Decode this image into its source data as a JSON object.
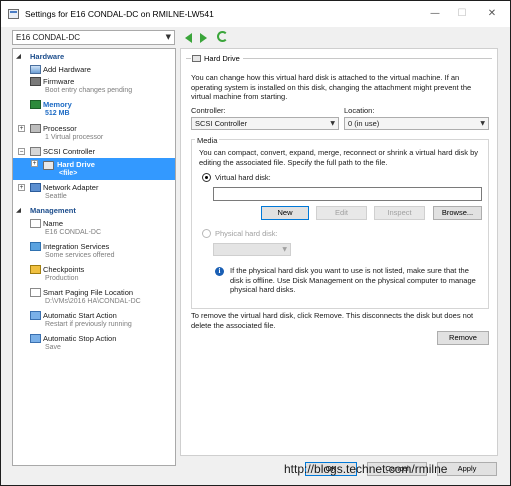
{
  "window": {
    "title": "Settings for E16 CONDAL-DC on RMILNE-LW541",
    "minimize_glyph": "—",
    "maximize_glyph": "☐",
    "close_glyph": "✕"
  },
  "toolbar": {
    "vm_name": "E16 CONDAL-DC",
    "back_icon": "back-arrow-icon",
    "forward_icon": "forward-arrow-icon",
    "refresh_icon": "refresh-icon"
  },
  "sidebar": {
    "hardware_heading": "Hardware",
    "management_heading": "Management",
    "hardware": [
      {
        "label": "Add Hardware",
        "sub": ""
      },
      {
        "label": "Firmware",
        "sub": "Boot entry changes pending"
      },
      {
        "label": "Memory",
        "sub": "512 MB"
      },
      {
        "label": "Processor",
        "sub": "1 Virtual processor"
      },
      {
        "label": "SCSI Controller",
        "sub": ""
      },
      {
        "label": "Hard Drive",
        "sub": "<file>"
      },
      {
        "label": "Network Adapter",
        "sub": "Seattle"
      }
    ],
    "management": [
      {
        "label": "Name",
        "sub": "E16 CONDAL-DC"
      },
      {
        "label": "Integration Services",
        "sub": "Some services offered"
      },
      {
        "label": "Checkpoints",
        "sub": "Production"
      },
      {
        "label": "Smart Paging File Location",
        "sub": "D:\\VMs\\2016 HA\\CONDAL-DC"
      },
      {
        "label": "Automatic Start Action",
        "sub": "Restart if previously running"
      },
      {
        "label": "Automatic Stop Action",
        "sub": "Save"
      }
    ]
  },
  "panel": {
    "title": "Hard Drive",
    "intro": "You can change how this virtual hard disk is attached to the virtual machine. If an operating system is installed on this disk, changing the attachment might prevent the virtual machine from starting.",
    "controller_label": "Controller:",
    "controller_value": "SCSI Controller",
    "location_label": "Location:",
    "location_value": "0 (in use)",
    "media_label": "Media",
    "media_desc": "You can compact, convert, expand, merge, reconnect or shrink a virtual hard disk by editing the associated file. Specify the full path to the file.",
    "virtual_disk_label": "Virtual hard disk:",
    "virtual_disk_path": "",
    "new_button": "New",
    "edit_button": "Edit",
    "inspect_button": "Inspect",
    "browse_button": "Browse...",
    "physical_disk_label": "Physical hard disk:",
    "physical_disk_value": "",
    "info_text": "If the physical hard disk you want to use is not listed, make sure that the disk is offline. Use Disk Management on the physical computer to manage physical hard disks.",
    "remove_desc": "To remove the virtual hard disk, click Remove. This disconnects the disk but does not delete the associated file.",
    "remove_button": "Remove"
  },
  "footer": {
    "ok_button": "OK",
    "cancel_button": "Cancel",
    "apply_button": "Apply",
    "watermark": "http://blogs.technet.com/rmilne"
  }
}
